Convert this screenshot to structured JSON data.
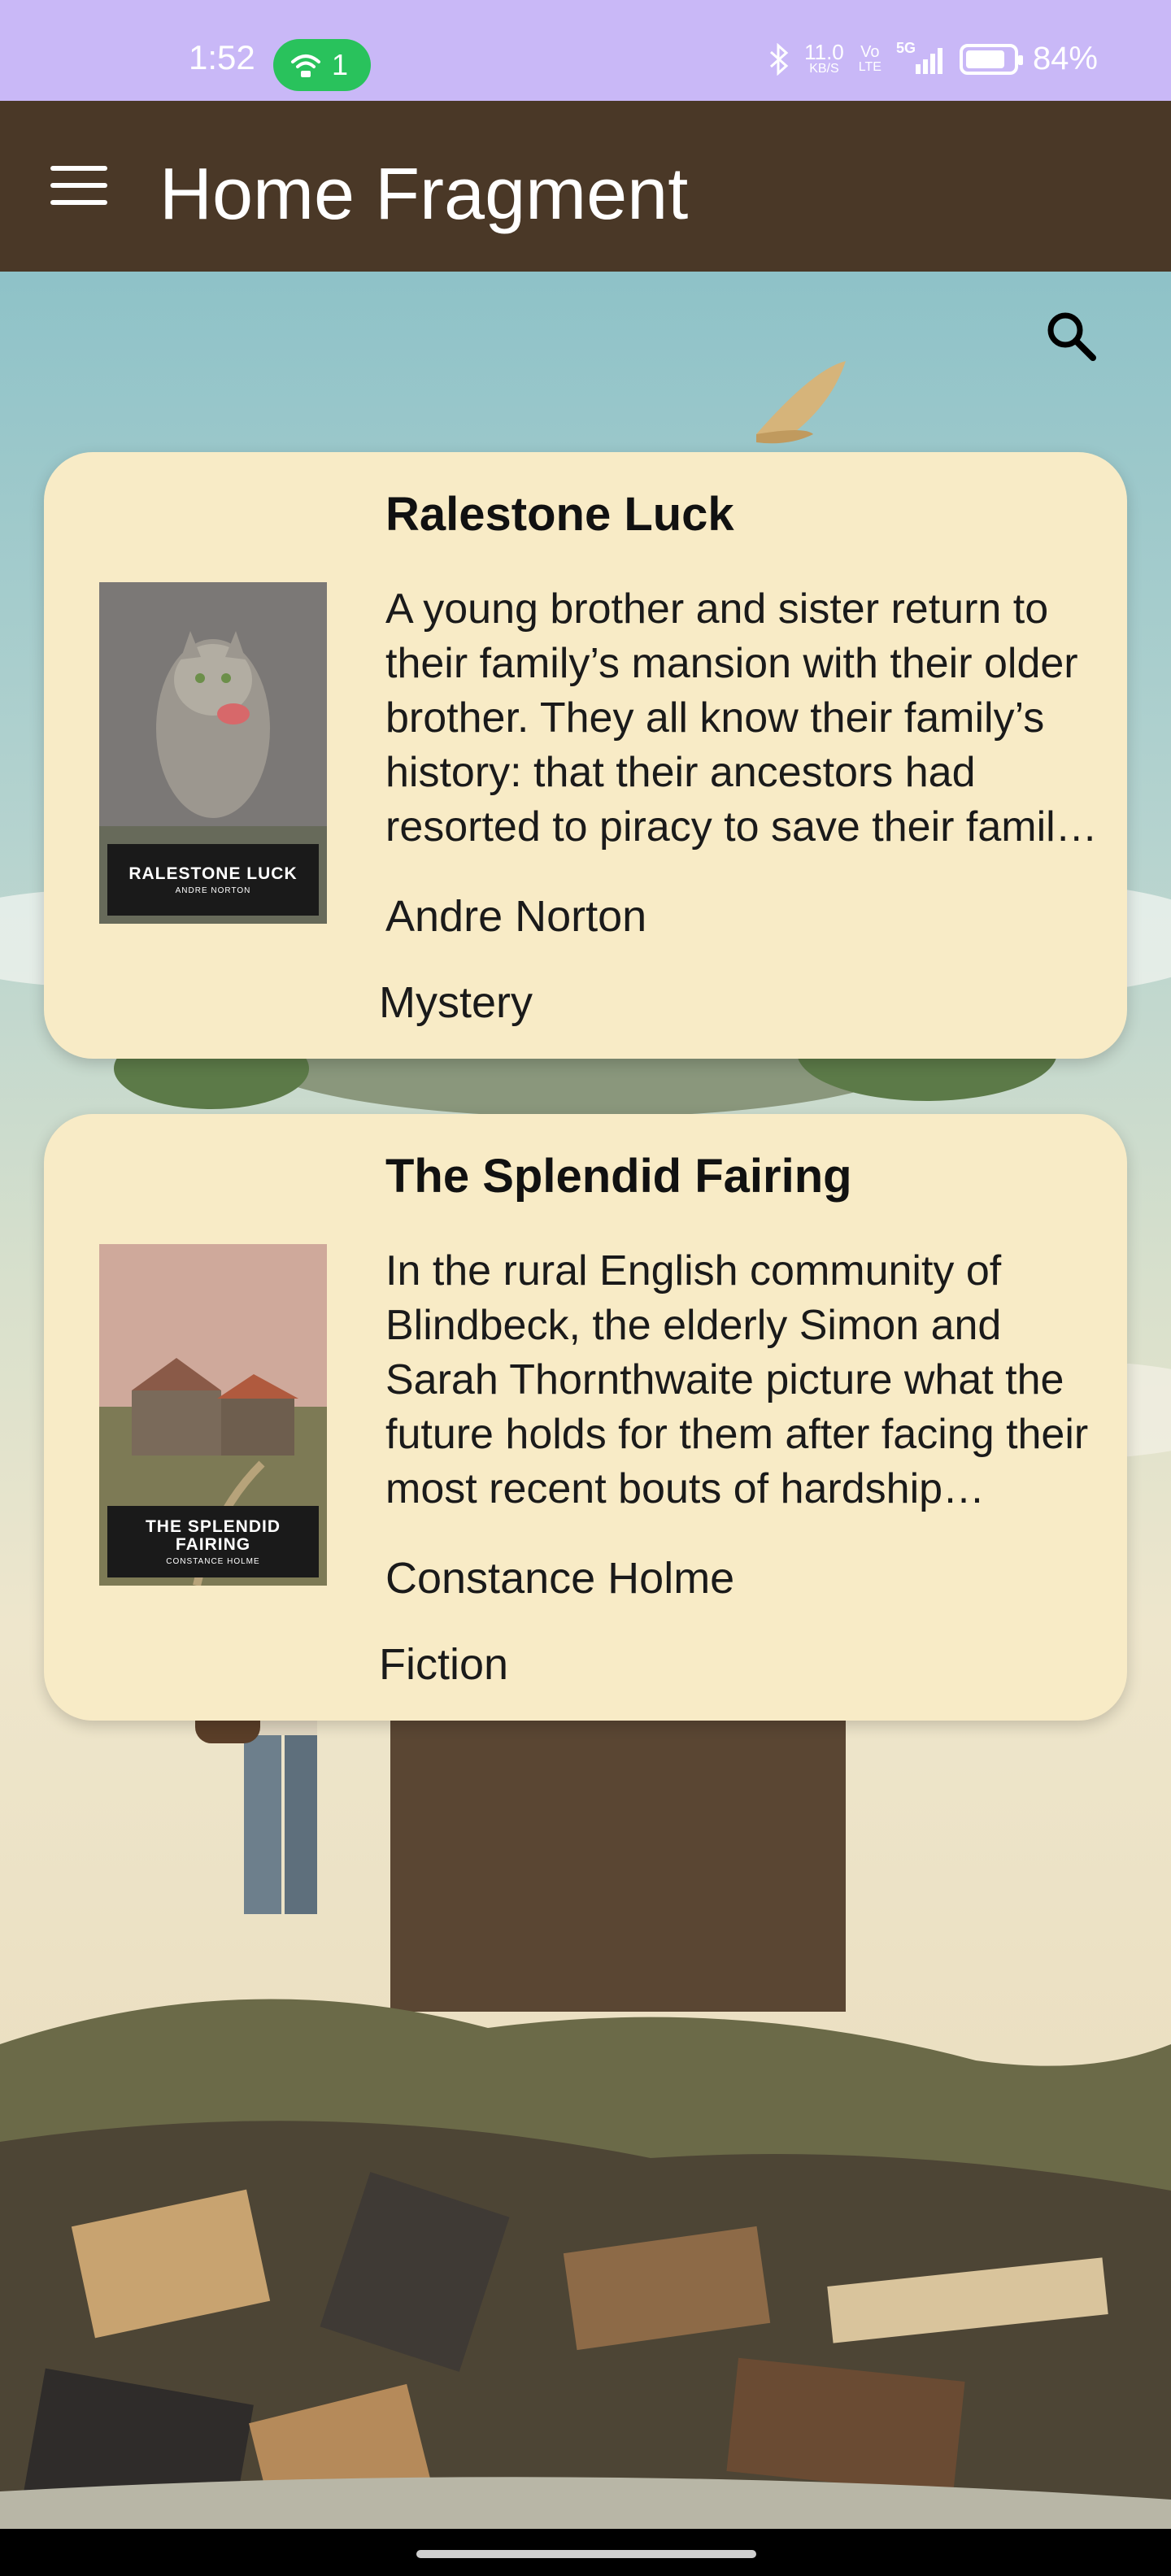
{
  "status_bar": {
    "time": "1:52",
    "hotspot_count": "1",
    "net_speed_top": "11.0",
    "net_speed_unit": "KB/S",
    "volte_top": "Vo",
    "volte_bottom": "LTE",
    "network": "5G",
    "battery_percent": "84%",
    "battery_level": 0.84
  },
  "app_bar": {
    "title": "Home Fragment",
    "menu_icon": "hamburger-menu-icon"
  },
  "search": {
    "icon": "search-icon"
  },
  "books": [
    {
      "title": "Ralestone Luck",
      "description": "A young brother and sister return to their family’s mansion with their older brother. They all know their family’s history: that their ancestors had resorted to piracy to save their family fortune…",
      "author": "Andre Norton",
      "genre": "Mystery",
      "cover_title": "RALESTONE LUCK",
      "cover_author": "ANDRE NORTON"
    },
    {
      "title": "The Splendid Fairing",
      "description": "In the rural English community of Blindbeck, the elderly Simon and Sarah Thornthwaite picture what the future holds for them after facing their most recent bouts of hardship…",
      "author": "Constance Holme",
      "genre": "Fiction",
      "cover_title": "THE SPLENDID FAIRING",
      "cover_author": "CONSTANCE HOLME"
    }
  ],
  "colors": {
    "status_bar": "#c9b8f7",
    "app_bar": "#4a3827",
    "card": "#f8ebc6",
    "hotspot": "#29c25c"
  }
}
